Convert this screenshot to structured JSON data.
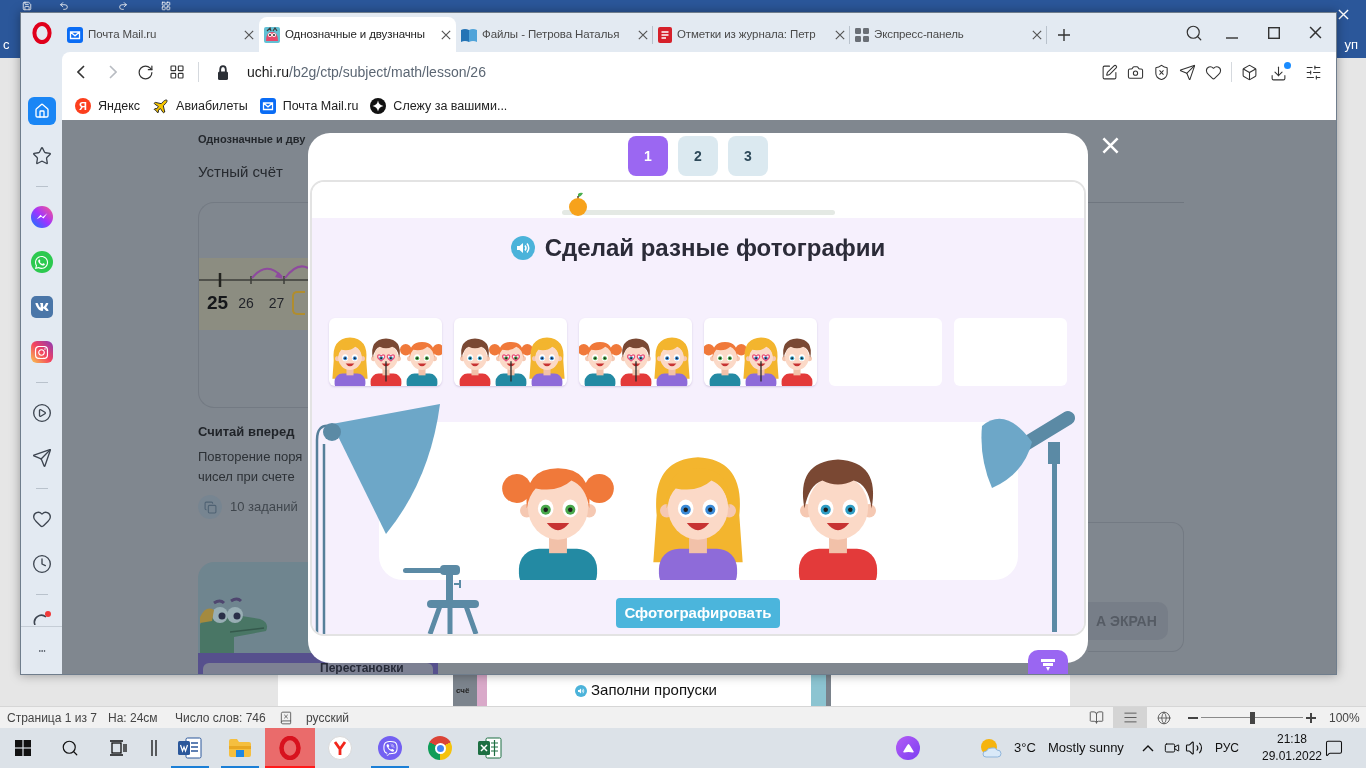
{
  "word": {
    "ribbon_fragments": [
      "с",
      "уп"
    ],
    "document": {
      "image_text": "счё",
      "heading": "Заполни пропуски"
    },
    "status_bar": {
      "page": "Страница 1 из 7",
      "position": "На: 24см",
      "word_count": "Число слов: 746",
      "language": "русский",
      "views": [
        {
          "selected": false
        },
        {
          "selected": true
        },
        {
          "selected": false
        }
      ],
      "zoom": {
        "level": 0.5,
        "reading": "100%"
      }
    }
  },
  "browser": {
    "tabs": [
      {
        "title": "Почта Mail.ru",
        "selected": false
      },
      {
        "title": "Однозначные и двузначны",
        "selected": true
      },
      {
        "title": "Файлы - Петрова Наталья",
        "selected": false
      },
      {
        "title": "Отметки из журнала: Петр",
        "selected": false
      },
      {
        "title": "Экспресс-панель",
        "selected": false
      }
    ],
    "nav_buttons": [
      {
        "disabled": false
      },
      {
        "disabled": true
      }
    ],
    "address": {
      "host": "uchi.ru",
      "path": "/b2g/ctp/subject/math/lesson/26"
    },
    "bookmarks": [
      {
        "label": "Яндекс",
        "logo_text": "Я"
      },
      {
        "label": "Авиабилеты"
      },
      {
        "label": "Почта Mail.ru"
      },
      {
        "label": "Слежу за вашими..."
      }
    ],
    "sidebar": {
      "items": [
        {
          "selected": true
        },
        {
          "selected": false
        },
        {
          "selected": false
        },
        {
          "selected": false
        },
        {
          "selected": false
        },
        {
          "selected": false
        },
        {
          "selected": false
        },
        {
          "selected": false
        },
        {
          "selected": false
        },
        {
          "selected": false
        },
        {
          "selected": false
        }
      ]
    }
  },
  "page": {
    "breadcrumb": "Однозначные и дву",
    "section_tab": "Устный счёт",
    "lesson": {
      "numbers": [
        {
          "label": "25",
          "highlighted": true
        },
        {
          "label": "26",
          "highlighted": false
        },
        {
          "label": "27",
          "highlighted": false
        }
      ],
      "title": "Считай вперед",
      "description_lines": [
        "Повторение поря",
        "чисел при счете"
      ],
      "task_count": "10 заданий"
    },
    "next_lesson": {
      "title": "Перестановки"
    },
    "side_button": "А ЭКРАН"
  },
  "modal": {
    "steps": [
      {
        "label": "1",
        "selected": true
      },
      {
        "label": "2",
        "selected": false
      },
      {
        "label": "3",
        "selected": false
      }
    ],
    "progress": {
      "level": 0
    },
    "title": "Сделай разные фотографии",
    "photos": [
      {
        "filled": true,
        "characters": [
          {
            "kind": "blonde_girl",
            "glasses": false
          },
          {
            "kind": "boy",
            "glasses": true
          },
          {
            "kind": "redhead_girl",
            "glasses": false
          }
        ]
      },
      {
        "filled": true,
        "characters": [
          {
            "kind": "boy",
            "glasses": false
          },
          {
            "kind": "redhead_girl",
            "glasses": true
          },
          {
            "kind": "blonde_girl",
            "glasses": false
          }
        ]
      },
      {
        "filled": true,
        "characters": [
          {
            "kind": "redhead_girl",
            "glasses": false
          },
          {
            "kind": "boy",
            "glasses": true
          },
          {
            "kind": "blonde_girl",
            "glasses": false
          }
        ]
      },
      {
        "filled": true,
        "characters": [
          {
            "kind": "redhead_girl",
            "glasses": false
          },
          {
            "kind": "blonde_girl",
            "glasses": true
          },
          {
            "kind": "boy",
            "glasses": false
          }
        ]
      },
      {
        "filled": false
      },
      {
        "filled": false
      }
    ],
    "stage": [
      {
        "kind": "redhead_girl",
        "glasses": false
      },
      {
        "kind": "blonde_girl",
        "glasses": false
      },
      {
        "kind": "boy",
        "glasses": false
      }
    ],
    "button": "Сфотографировать"
  },
  "taskbar": {
    "apps": [
      {
        "open": true,
        "active": false
      },
      {
        "open": true,
        "active": false
      },
      {
        "open": true,
        "active": true
      },
      {
        "open": false,
        "active": false
      },
      {
        "open": true,
        "active": false
      },
      {
        "open": false,
        "active": false
      },
      {
        "open": false,
        "active": false
      }
    ],
    "weather": {
      "temperature": "3°C",
      "condition": "Mostly sunny"
    },
    "input_language": "РУС",
    "time": "21:18",
    "date": "29.01.2022"
  }
}
